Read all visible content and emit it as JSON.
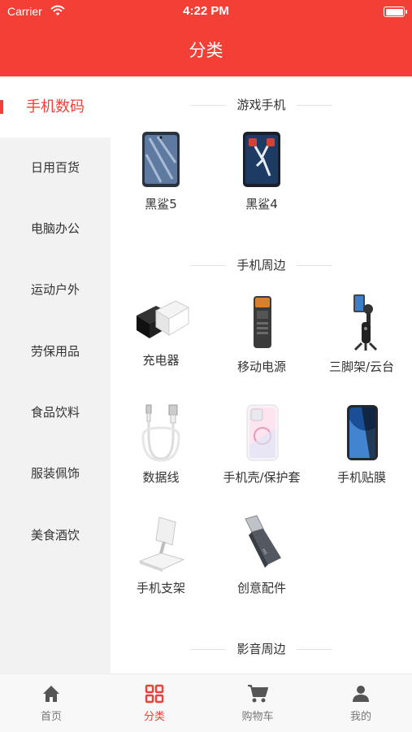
{
  "status": {
    "carrier": "Carrier",
    "time": "4:22 PM"
  },
  "header": {
    "title": "分类"
  },
  "sidebar": {
    "items": [
      {
        "label": "手机数码",
        "active": true
      },
      {
        "label": "日用百货"
      },
      {
        "label": "电脑办公"
      },
      {
        "label": "运动户外"
      },
      {
        "label": "劳保用品"
      },
      {
        "label": "食品饮料"
      },
      {
        "label": "服装佩饰"
      },
      {
        "label": "美食酒饮"
      }
    ]
  },
  "sections": [
    {
      "title": "游戏手机",
      "items": [
        {
          "label": "黑鲨5",
          "icon": "phone-black-shark-5"
        },
        {
          "label": "黑鲨4",
          "icon": "phone-black-shark-4"
        }
      ]
    },
    {
      "title": "手机周边",
      "items": [
        {
          "label": "充电器",
          "icon": "charger"
        },
        {
          "label": "移动电源",
          "icon": "power-bank"
        },
        {
          "label": "三脚架/云台",
          "icon": "gimbal"
        },
        {
          "label": "数据线",
          "icon": "cable"
        },
        {
          "label": "手机壳/保护套",
          "icon": "phone-case"
        },
        {
          "label": "手机贴膜",
          "icon": "screen-protector"
        },
        {
          "label": "手机支架",
          "icon": "phone-stand"
        },
        {
          "label": "创意配件",
          "icon": "usb-adapter"
        }
      ]
    },
    {
      "title": "影音周边",
      "items": []
    }
  ],
  "tabbar": {
    "items": [
      {
        "label": "首页",
        "icon": "home-icon"
      },
      {
        "label": "分类",
        "icon": "grid-icon",
        "active": true
      },
      {
        "label": "购物车",
        "icon": "cart-icon"
      },
      {
        "label": "我的",
        "icon": "user-icon"
      }
    ]
  },
  "colors": {
    "accent": "#f33f35",
    "sidebar_bg": "#f2f2f2",
    "tabbar_bg": "#f8f8f8"
  }
}
